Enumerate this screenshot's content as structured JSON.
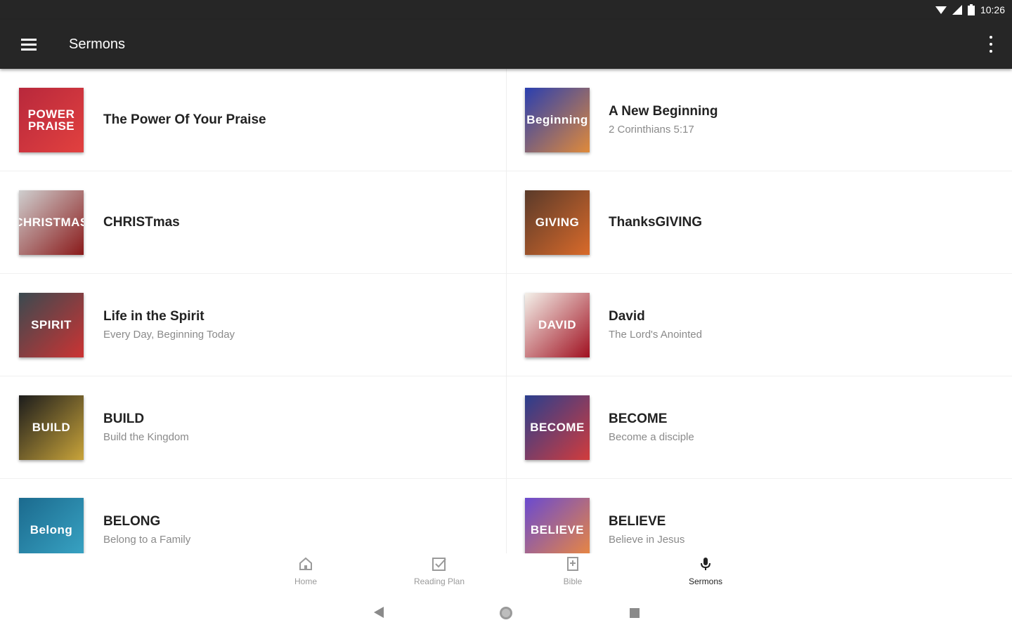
{
  "status": {
    "time": "10:26",
    "icons": [
      "wifi-icon",
      "cell-signal-icon",
      "battery-icon"
    ]
  },
  "appbar": {
    "title": "Sermons",
    "menu_icon": "menu-icon",
    "overflow_icon": "more-vertical-icon"
  },
  "sermons": [
    {
      "title": "The Power Of Your Praise",
      "subtitle": "",
      "thumb_text": "POWER PRAISE",
      "colors": [
        "#b8283c",
        "#e2413f"
      ]
    },
    {
      "title": "A New Beginning",
      "subtitle": "2 Corinthians 5:17",
      "thumb_text": "Beginning",
      "colors": [
        "#2a3fb0",
        "#e08a3a"
      ]
    },
    {
      "title": "CHRISTmas",
      "subtitle": "",
      "thumb_text": "CHRISTMAS",
      "colors": [
        "#cfcfcf",
        "#8a1a1a"
      ]
    },
    {
      "title": "ThanksGIVING",
      "subtitle": "",
      "thumb_text": "GIVING",
      "colors": [
        "#5a3a2a",
        "#d96a2a"
      ]
    },
    {
      "title": "Life in the Spirit",
      "subtitle": "Every Day, Beginning Today",
      "thumb_text": "SPIRIT",
      "colors": [
        "#3a4a50",
        "#c33"
      ]
    },
    {
      "title": "David",
      "subtitle": "The Lord's Anointed",
      "thumb_text": "DAVID",
      "colors": [
        "#f4f1ea",
        "#a01020"
      ]
    },
    {
      "title": "BUILD",
      "subtitle": "Build the Kingdom",
      "thumb_text": "BUILD",
      "colors": [
        "#1c1c1c",
        "#c9a43a"
      ]
    },
    {
      "title": "BECOME",
      "subtitle": "Become a disciple",
      "thumb_text": "BECOME",
      "colors": [
        "#2a3e8e",
        "#d23c3c"
      ]
    },
    {
      "title": "BELONG",
      "subtitle": "Belong to a Family",
      "thumb_text": "Belong",
      "colors": [
        "#1b6a8e",
        "#3aa6c6"
      ]
    },
    {
      "title": "BELIEVE",
      "subtitle": "Believe in Jesus",
      "thumb_text": "BELIEVE",
      "colors": [
        "#6a4ad0",
        "#ef8a3a"
      ]
    }
  ],
  "bottom_nav": [
    {
      "label": "Home",
      "icon": "home-icon",
      "active": false
    },
    {
      "label": "Reading Plan",
      "icon": "checkbox-icon",
      "active": false
    },
    {
      "label": "Bible",
      "icon": "book-plus-icon",
      "active": false
    },
    {
      "label": "Sermons",
      "icon": "microphone-icon",
      "active": true
    }
  ],
  "system_nav": [
    "back-icon",
    "home-circle-icon",
    "recents-icon"
  ]
}
